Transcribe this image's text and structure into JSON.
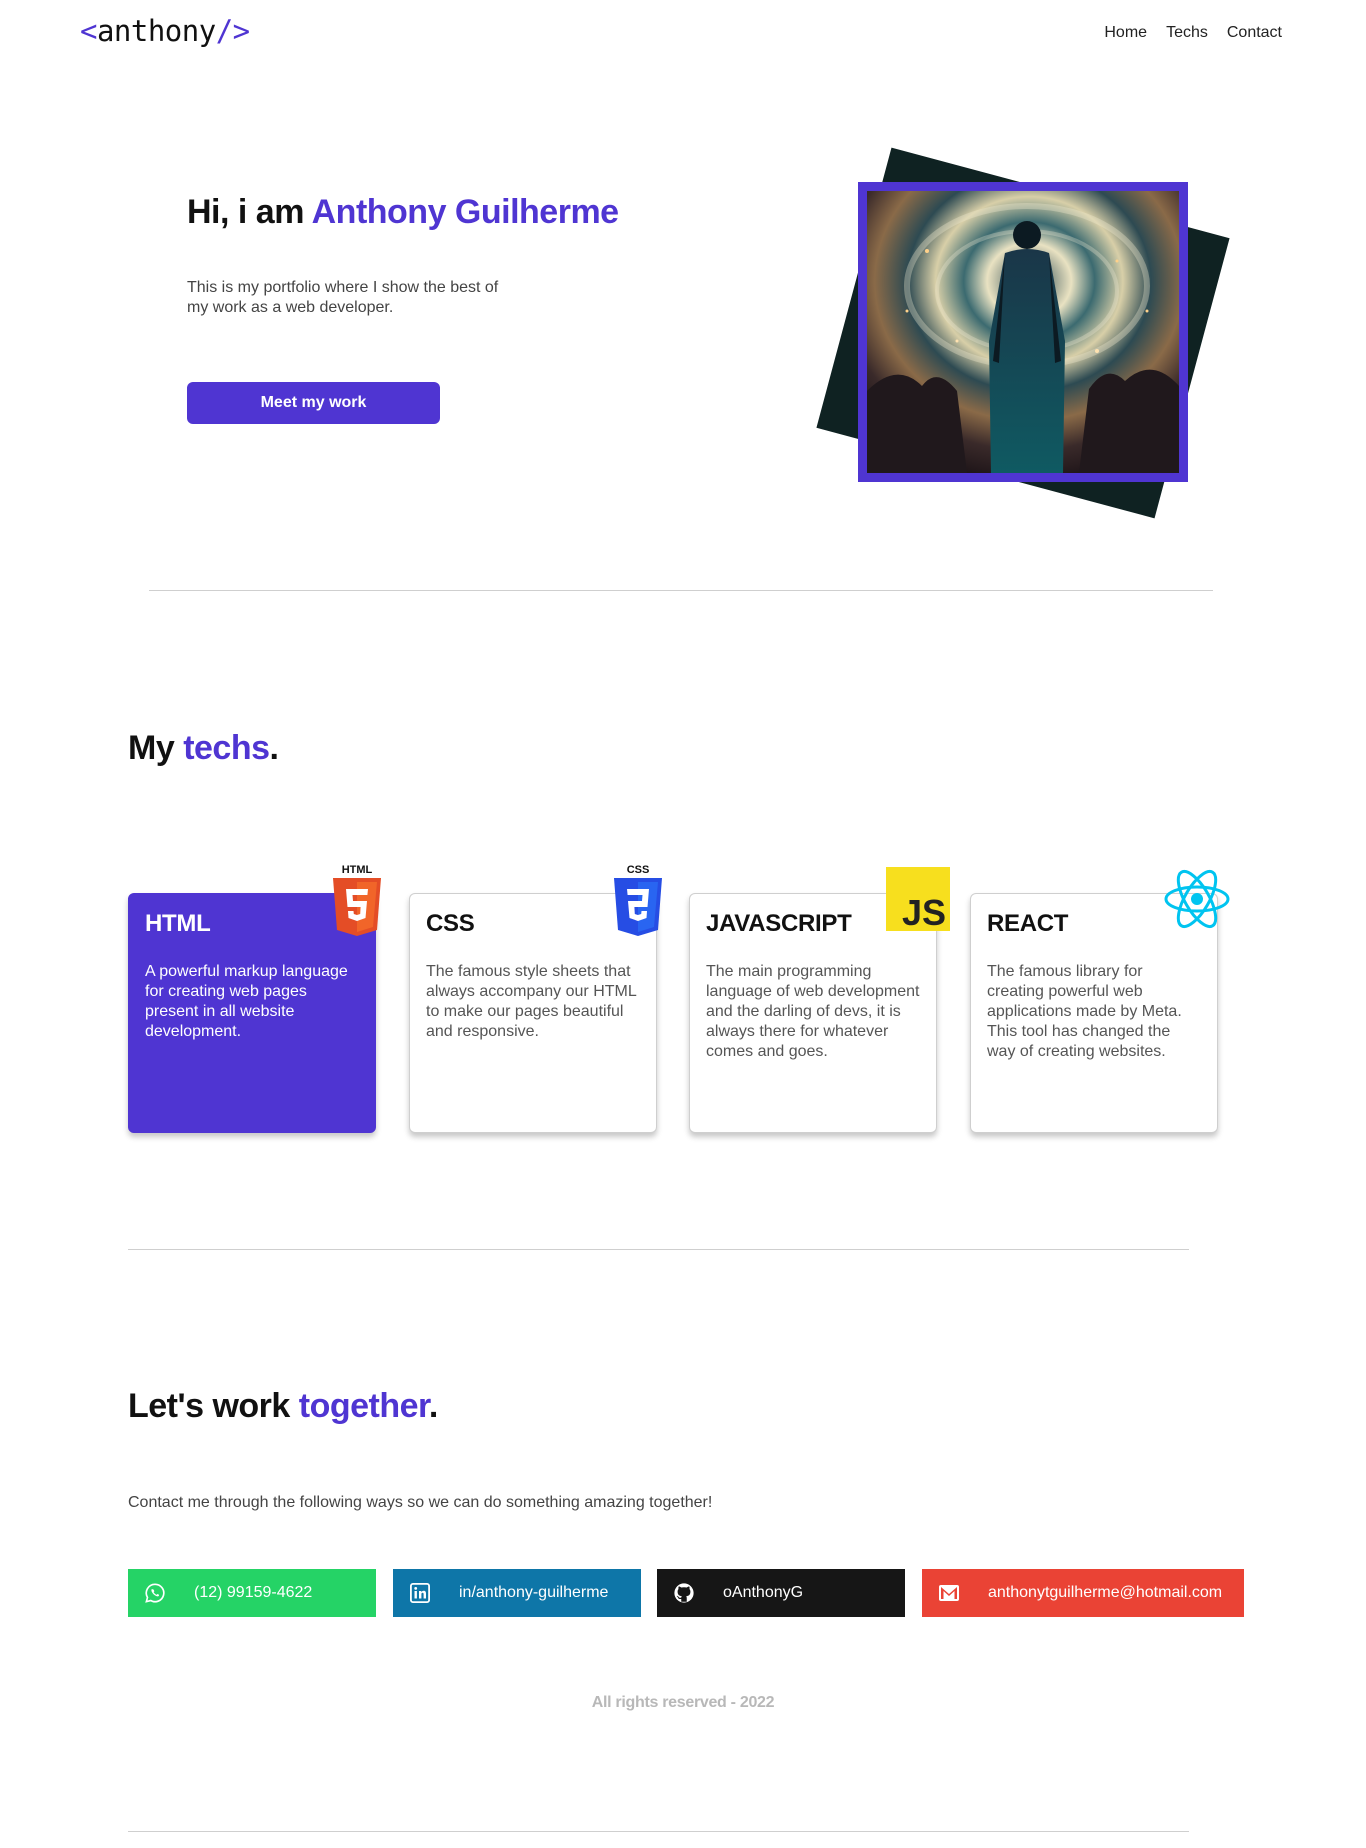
{
  "header": {
    "logo_open": "<",
    "logo_name": "anthony",
    "logo_close": "/>",
    "nav": [
      "Home",
      "Techs",
      "Contact"
    ]
  },
  "hero": {
    "greeting": "Hi, i am ",
    "name": "Anthony Guilherme",
    "description": "This is my portfolio where I show the best of my work as a web developer.",
    "button_label": "Meet my work"
  },
  "techs": {
    "title_prefix": "My ",
    "title_accent": "techs",
    "title_suffix": ".",
    "cards": [
      {
        "title": "HTML",
        "description": "A powerful markup language for creating web pages present in all website development.",
        "icon": "html5-icon",
        "icon_label": "HTML"
      },
      {
        "title": "CSS",
        "description": "The famous style sheets that always accompany our HTML to make our pages beautiful and responsive.",
        "icon": "css3-icon",
        "icon_label": "CSS"
      },
      {
        "title": "JAVASCRIPT",
        "description": "The main programming language of web development and the darling of devs, it is always there for whatever comes and goes.",
        "icon": "js-icon",
        "icon_label": "JS"
      },
      {
        "title": "REACT",
        "description": "The famous library for creating powerful web applications made by Meta. This tool has changed the way of creating websites.",
        "icon": "react-icon"
      }
    ]
  },
  "contact": {
    "title_prefix": "Let's work ",
    "title_accent": "together",
    "title_suffix": ".",
    "description": "Contact me through the following ways so we can do something amazing together!",
    "links": [
      {
        "label": "(12) 99159-4622",
        "icon": "whatsapp-icon",
        "color": "#25d366"
      },
      {
        "label": "in/anthony-guilherme",
        "icon": "linkedin-icon",
        "color": "#0e76a8"
      },
      {
        "label": "oAnthonyG",
        "icon": "github-icon",
        "color": "#161616"
      },
      {
        "label": "anthonytguilherme@hotmail.com",
        "icon": "mail-icon",
        "color": "#ea4335"
      }
    ]
  },
  "footer": {
    "text": "All rights reserved - 2022"
  },
  "colors": {
    "accent": "#4f35d2",
    "photo_shadow": "#0f2222"
  }
}
